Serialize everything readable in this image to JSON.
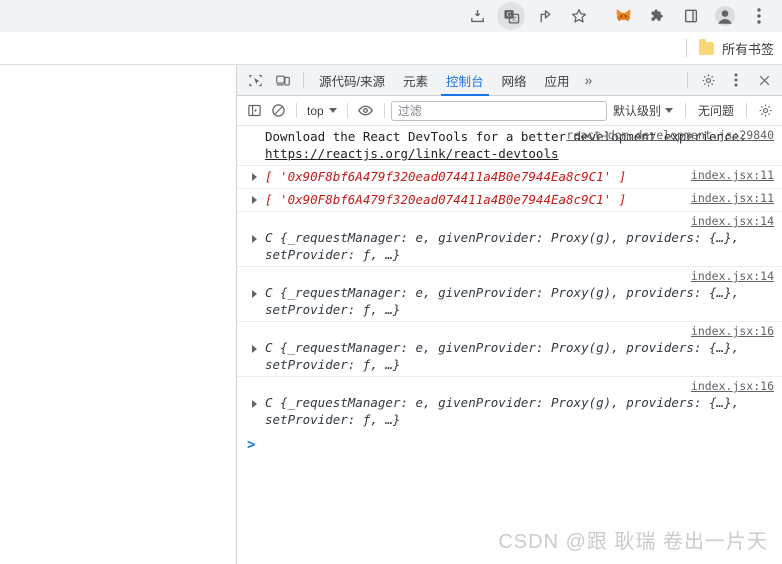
{
  "browser": {
    "toolbar_icons": [
      {
        "name": "download-icon",
        "glyph": "⤓",
        "active": false
      },
      {
        "name": "translate-icon",
        "glyph": "文",
        "active": true
      },
      {
        "name": "share-icon",
        "glyph": "↷",
        "active": false
      },
      {
        "name": "bookmark-star-icon",
        "glyph": "☆",
        "active": false
      },
      {
        "name": "metamask-fox-icon",
        "glyph": "🦊",
        "active": false
      },
      {
        "name": "extensions-puzzle-icon",
        "glyph": "🧩",
        "active": false
      },
      {
        "name": "side-panel-icon",
        "glyph": "▯",
        "active": false
      },
      {
        "name": "profile-avatar-icon",
        "glyph": "●",
        "active": false
      },
      {
        "name": "chrome-menu-icon",
        "glyph": "⋮",
        "active": false
      }
    ],
    "bookmarks": {
      "folder_icon": "folder-icon",
      "all_bookmarks_label": "所有书签"
    }
  },
  "devtools": {
    "tools": [
      {
        "name": "inspect-element-icon",
        "glyph": "⌖"
      },
      {
        "name": "device-toolbar-icon",
        "glyph": "▭"
      }
    ],
    "tabs": [
      {
        "label": "源代码/来源",
        "selected": false
      },
      {
        "label": "元素",
        "selected": false
      },
      {
        "label": "控制台",
        "selected": true
      },
      {
        "label": "网络",
        "selected": false
      },
      {
        "label": "应用",
        "selected": false
      }
    ],
    "more_tabs_label": "»",
    "settings_icon": "gear-icon",
    "menu_icon": "kebab-menu-icon",
    "close_icon": "close-icon",
    "filterbar": {
      "sidebar_toggle_icon": "console-sidebar-icon",
      "clear_console_icon": "clear-console-icon",
      "context_value": "top",
      "eye_icon": "live-expression-eye-icon",
      "filter_placeholder": "过滤",
      "filter_value": "",
      "level_value": "默认级别",
      "issues_label": "无问题",
      "settings_icon": "console-settings-gear-icon"
    }
  },
  "console": {
    "messages": [
      {
        "kind": "text",
        "source": "react-dom.development.js:29840",
        "text": "Download the React DevTools for a better development experience:",
        "link": "https://reactjs.org/link/react-devtools",
        "expandable": false
      },
      {
        "kind": "array",
        "source": "index.jsx:11",
        "text": "[ '0x90F8bf6A479f320ead074411a4B0e7944Ea8c9C1' ]",
        "expandable": true
      },
      {
        "kind": "array",
        "source": "index.jsx:11",
        "text": "[ '0x90F8bf6A479f320ead074411a4B0e7944Ea8c9C1' ]",
        "expandable": true
      },
      {
        "kind": "object",
        "source": "index.jsx:14",
        "text": "C {_requestManager: e, givenProvider: Proxy(g), providers: {…}, setProvider: ƒ, …}",
        "expandable": true
      },
      {
        "kind": "object",
        "source": "index.jsx:14",
        "text": "C {_requestManager: e, givenProvider: Proxy(g), providers: {…}, setProvider: ƒ, …}",
        "expandable": true
      },
      {
        "kind": "object",
        "source": "index.jsx:16",
        "text": "C {_requestManager: e, givenProvider: Proxy(g), providers: {…}, setProvider: ƒ, …}",
        "expandable": true
      },
      {
        "kind": "object",
        "source": "index.jsx:16",
        "text": "C {_requestManager: e, givenProvider: Proxy(g), providers: {…}, setProvider: ƒ, …}",
        "expandable": true
      }
    ],
    "prompt_caret": ">"
  },
  "watermark": "CSDN @跟 耿瑞 卷出一片天",
  "colors": {
    "accent_blue": "#1a73e8",
    "string_red": "#c41a16",
    "chrome_bg": "#f1f3f4",
    "folder_yellow": "#f8d775"
  }
}
